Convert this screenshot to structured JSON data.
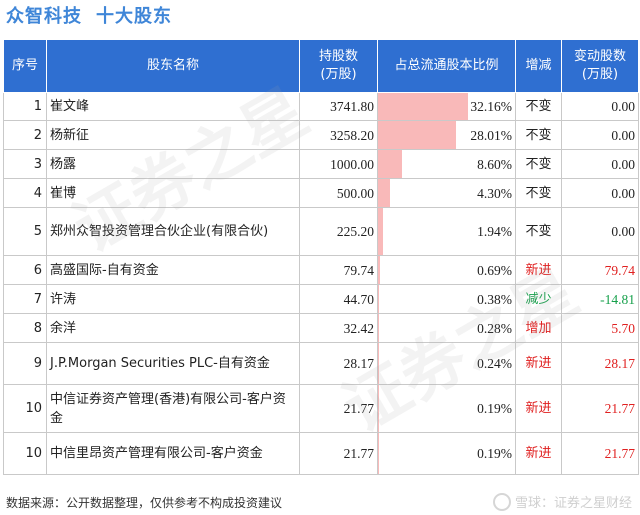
{
  "title": {
    "company": "众智科技",
    "section": "十大股东"
  },
  "columns": [
    "序号",
    "股东名称",
    "持股数(万股)",
    "占总流通股本比例",
    "增减",
    "变动股数(万股)"
  ],
  "columns_lines": {
    "shares": [
      "持股数",
      "(万股)"
    ],
    "change": [
      "变动股数",
      "(万股)"
    ]
  },
  "rows": [
    {
      "idx": "1",
      "name": "崔文峰",
      "shares": "3741.80",
      "pct": "32.16%",
      "pct_value": 32.16,
      "change_type": "不变",
      "change": "0.00",
      "color": "black"
    },
    {
      "idx": "2",
      "name": "杨新征",
      "shares": "3258.20",
      "pct": "28.01%",
      "pct_value": 28.01,
      "change_type": "不变",
      "change": "0.00",
      "color": "black"
    },
    {
      "idx": "3",
      "name": "杨露",
      "shares": "1000.00",
      "pct": "8.60%",
      "pct_value": 8.6,
      "change_type": "不变",
      "change": "0.00",
      "color": "black"
    },
    {
      "idx": "4",
      "name": "崔博",
      "shares": "500.00",
      "pct": "4.30%",
      "pct_value": 4.3,
      "change_type": "不变",
      "change": "0.00",
      "color": "black"
    },
    {
      "idx": "5",
      "name": "郑州众智投资管理合伙企业(有限合伙)",
      "shares": "225.20",
      "pct": "1.94%",
      "pct_value": 1.94,
      "change_type": "不变",
      "change": "0.00",
      "color": "black"
    },
    {
      "idx": "6",
      "name": "高盛国际-自有资金",
      "shares": "79.74",
      "pct": "0.69%",
      "pct_value": 0.69,
      "change_type": "新进",
      "change": "79.74",
      "color": "red"
    },
    {
      "idx": "7",
      "name": "许涛",
      "shares": "44.70",
      "pct": "0.38%",
      "pct_value": 0.38,
      "change_type": "减少",
      "change": "-14.81",
      "color": "green"
    },
    {
      "idx": "8",
      "name": "余洋",
      "shares": "32.42",
      "pct": "0.28%",
      "pct_value": 0.28,
      "change_type": "增加",
      "change": "5.70",
      "color": "red"
    },
    {
      "idx": "9",
      "name": "J.P.Morgan Securities PLC-自有资金",
      "shares": "28.17",
      "pct": "0.24%",
      "pct_value": 0.24,
      "change_type": "新进",
      "change": "28.17",
      "color": "red"
    },
    {
      "idx": "10",
      "name": "中信证券资产管理(香港)有限公司-客户资金",
      "shares": "21.77",
      "pct": "0.19%",
      "pct_value": 0.19,
      "change_type": "新进",
      "change": "21.77",
      "color": "red"
    },
    {
      "idx": "10",
      "name": "中信里昂资产管理有限公司-客户资金",
      "shares": "21.77",
      "pct": "0.19%",
      "pct_value": 0.19,
      "change_type": "新进",
      "change": "21.77",
      "color": "red"
    }
  ],
  "footer": {
    "source": "数据来源：公开数据整理，仅供参考不构成投资建议",
    "brand": "雪球：证券之星财经"
  },
  "watermark": "证券之星",
  "colors": {
    "header_bg": "#2f6fd1",
    "title": "#3f86d8",
    "bar": "#f9b9b9",
    "increase": "#e02020",
    "decrease": "#16a04b"
  }
}
